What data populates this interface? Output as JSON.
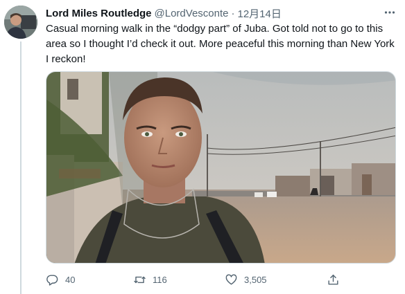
{
  "tweet": {
    "author": {
      "display_name": "Lord Miles Routledge",
      "handle": "@LordVesconte",
      "avatar_icon": "profile-photo"
    },
    "separator": "·",
    "date": "12月14日",
    "more_icon": "more-horizontal-icon",
    "text": "Casual morning walk in the “dodgy part” of Juba. Got told not to go to this area so I thought I’d check it out. More peaceful this morning than New York I reckon!",
    "media": {
      "type": "photo"
    },
    "actions": {
      "reply": {
        "icon": "reply-icon",
        "count": "40"
      },
      "retweet": {
        "icon": "retweet-icon",
        "count": "116"
      },
      "like": {
        "icon": "heart-icon",
        "count": "3,505"
      },
      "share": {
        "icon": "share-icon"
      }
    }
  },
  "colors": {
    "text_primary": "#0f1419",
    "text_secondary": "#536471",
    "thread_line": "#cfd9de"
  }
}
